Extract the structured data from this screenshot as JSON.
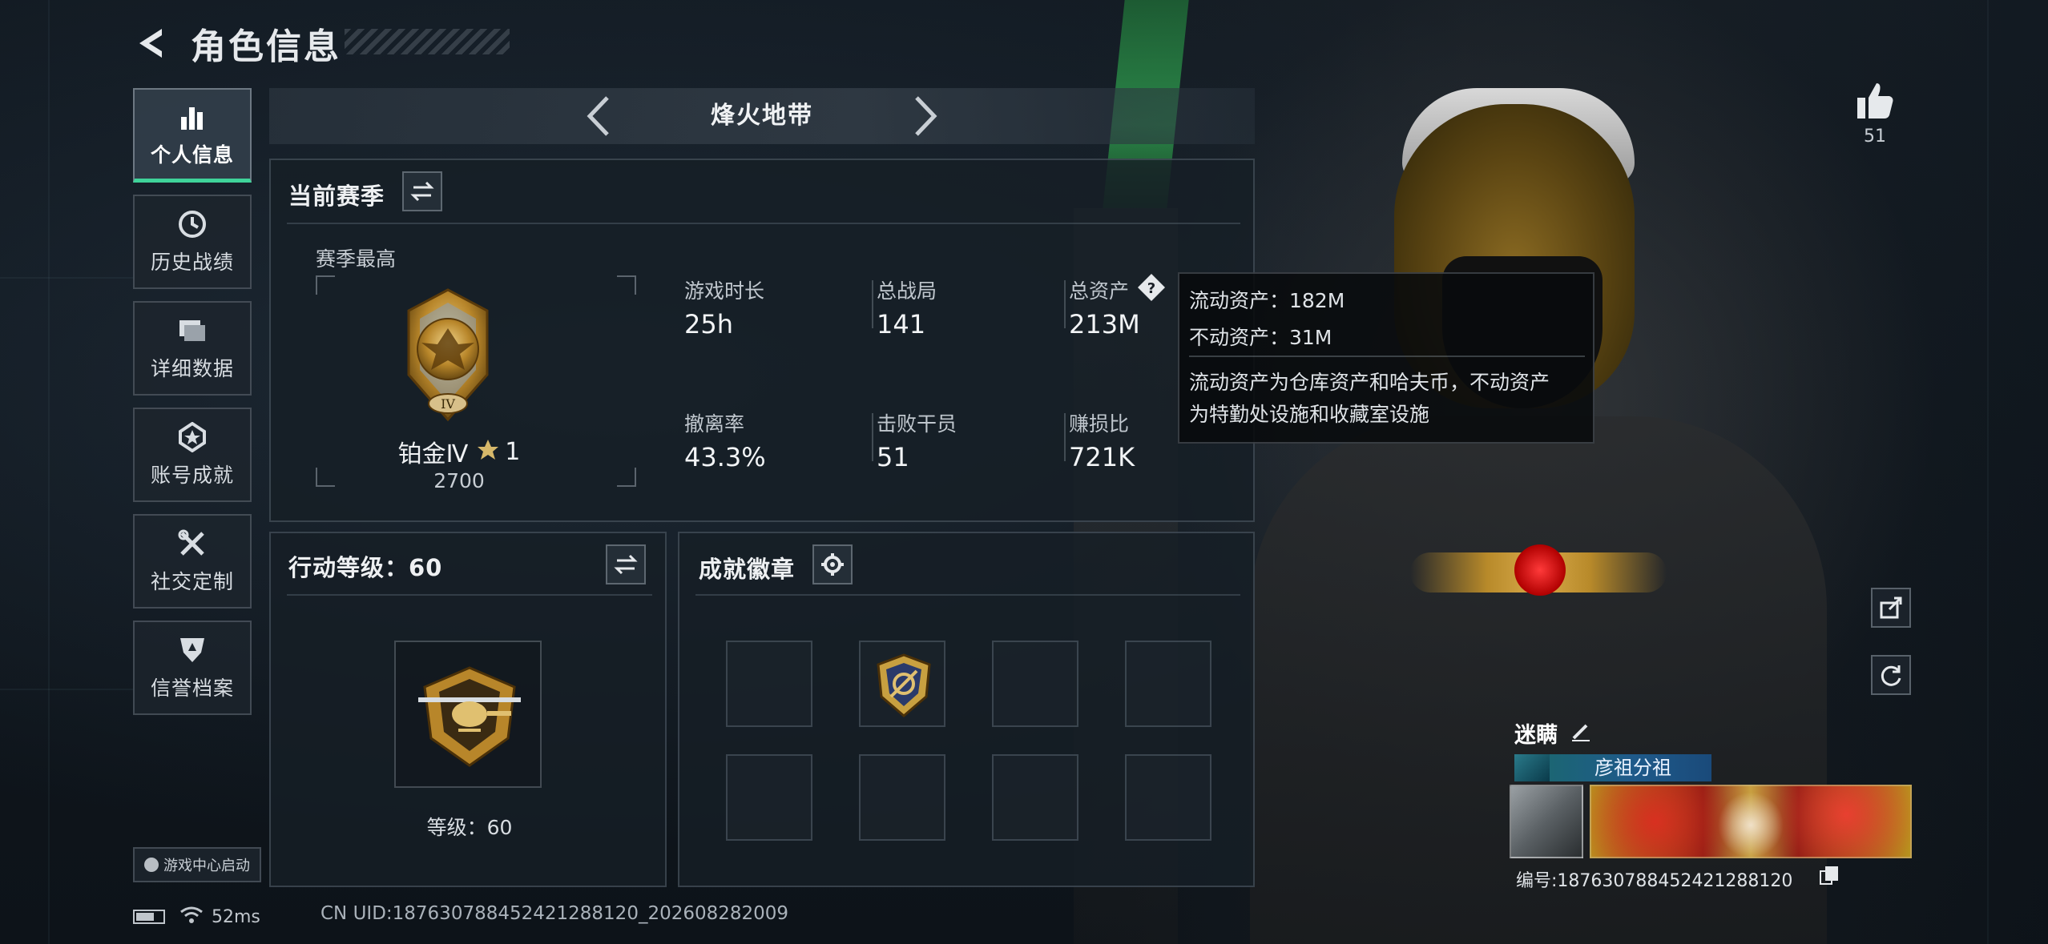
{
  "header": {
    "title": "角色信息"
  },
  "sidebar": {
    "items": [
      {
        "label": "个人信息",
        "icon": "bar-chart-icon",
        "active": true
      },
      {
        "label": "历史战绩",
        "icon": "history-clock-icon",
        "active": false
      },
      {
        "label": "详细数据",
        "icon": "folder-icon",
        "active": false
      },
      {
        "label": "账号成就",
        "icon": "achievement-icon",
        "active": false
      },
      {
        "label": "社交定制",
        "icon": "tools-icon",
        "active": false
      },
      {
        "label": "信誉档案",
        "icon": "shield-badge-icon",
        "active": false
      }
    ],
    "game_center_label": "游戏中心启动"
  },
  "map": {
    "name": "烽火地带"
  },
  "season": {
    "title": "当前赛季",
    "highest_label": "赛季最高",
    "rank_name": "铂金Ⅳ",
    "rank_stars": "1",
    "rank_points": "2700",
    "stats": [
      {
        "label": "游戏时长",
        "value": "25h"
      },
      {
        "label": "总战局",
        "value": "141"
      },
      {
        "label": "总资产",
        "value": "213M"
      },
      {
        "label": "撤离率",
        "value": "43.3%"
      },
      {
        "label": "击败干员",
        "value": "51"
      },
      {
        "label": "赚损比",
        "value": "721K"
      }
    ]
  },
  "tooltip": {
    "liquid": "流动资产：182M",
    "fixed": "不动资产：31M",
    "desc_line1": "流动资产为仓库资产和哈夫币，不动资产",
    "desc_line2": "为特勤处设施和收藏室设施"
  },
  "action_level": {
    "title": "行动等级：60",
    "level_label": "等级：60"
  },
  "badges": {
    "title": "成就徽章"
  },
  "profile": {
    "likes": "51",
    "name": "迷瞒",
    "clan": "彦祖分祖",
    "id_text": "编号:1876307884524212881​20"
  },
  "status": {
    "ping": "52ms",
    "battery_level": 0.7,
    "uid": "CN UID:1876307884524212881​20_202608282009"
  },
  "colors": {
    "accent_green": "#3fd39a",
    "gold": "#c8a040"
  }
}
